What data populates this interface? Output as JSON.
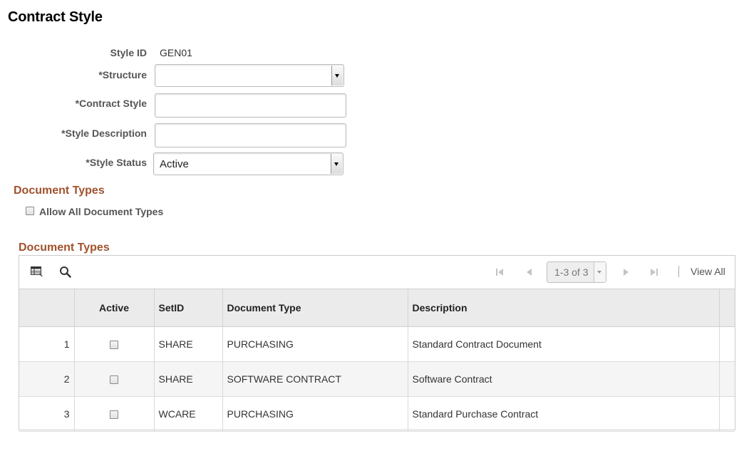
{
  "page": {
    "title": "Contract Style"
  },
  "form": {
    "style_id": {
      "label": "Style ID",
      "value": "GEN01"
    },
    "structure": {
      "label": "*Structure",
      "value": ""
    },
    "contract_style": {
      "label": "*Contract Style",
      "value": ""
    },
    "style_description": {
      "label": "*Style Description",
      "value": ""
    },
    "style_status": {
      "label": "*Style Status",
      "value": "Active"
    }
  },
  "document_types_section": {
    "heading": "Document Types",
    "allow_all": {
      "label": "Allow All Document Types",
      "checked": false
    }
  },
  "grid": {
    "title": "Document Types",
    "pager": {
      "range": "1-3 of 3",
      "view_all": "View All"
    },
    "columns": {
      "row_num": "",
      "active": "Active",
      "setid": "SetID",
      "document_type": "Document Type",
      "description": "Description"
    },
    "rows": [
      {
        "num": "1",
        "active": false,
        "setid": "SHARE",
        "document_type": "PURCHASING",
        "description": "Standard Contract Document"
      },
      {
        "num": "2",
        "active": false,
        "setid": "SHARE",
        "document_type": "SOFTWARE CONTRACT",
        "description": "Software Contract"
      },
      {
        "num": "3",
        "active": false,
        "setid": "WCARE",
        "document_type": "PURCHASING",
        "description": "Standard Purchase Contract"
      }
    ]
  },
  "colors": {
    "section_heading": "#a0522d",
    "header_bg": "#ebebeb",
    "alt_row_bg": "#f5f5f5"
  }
}
